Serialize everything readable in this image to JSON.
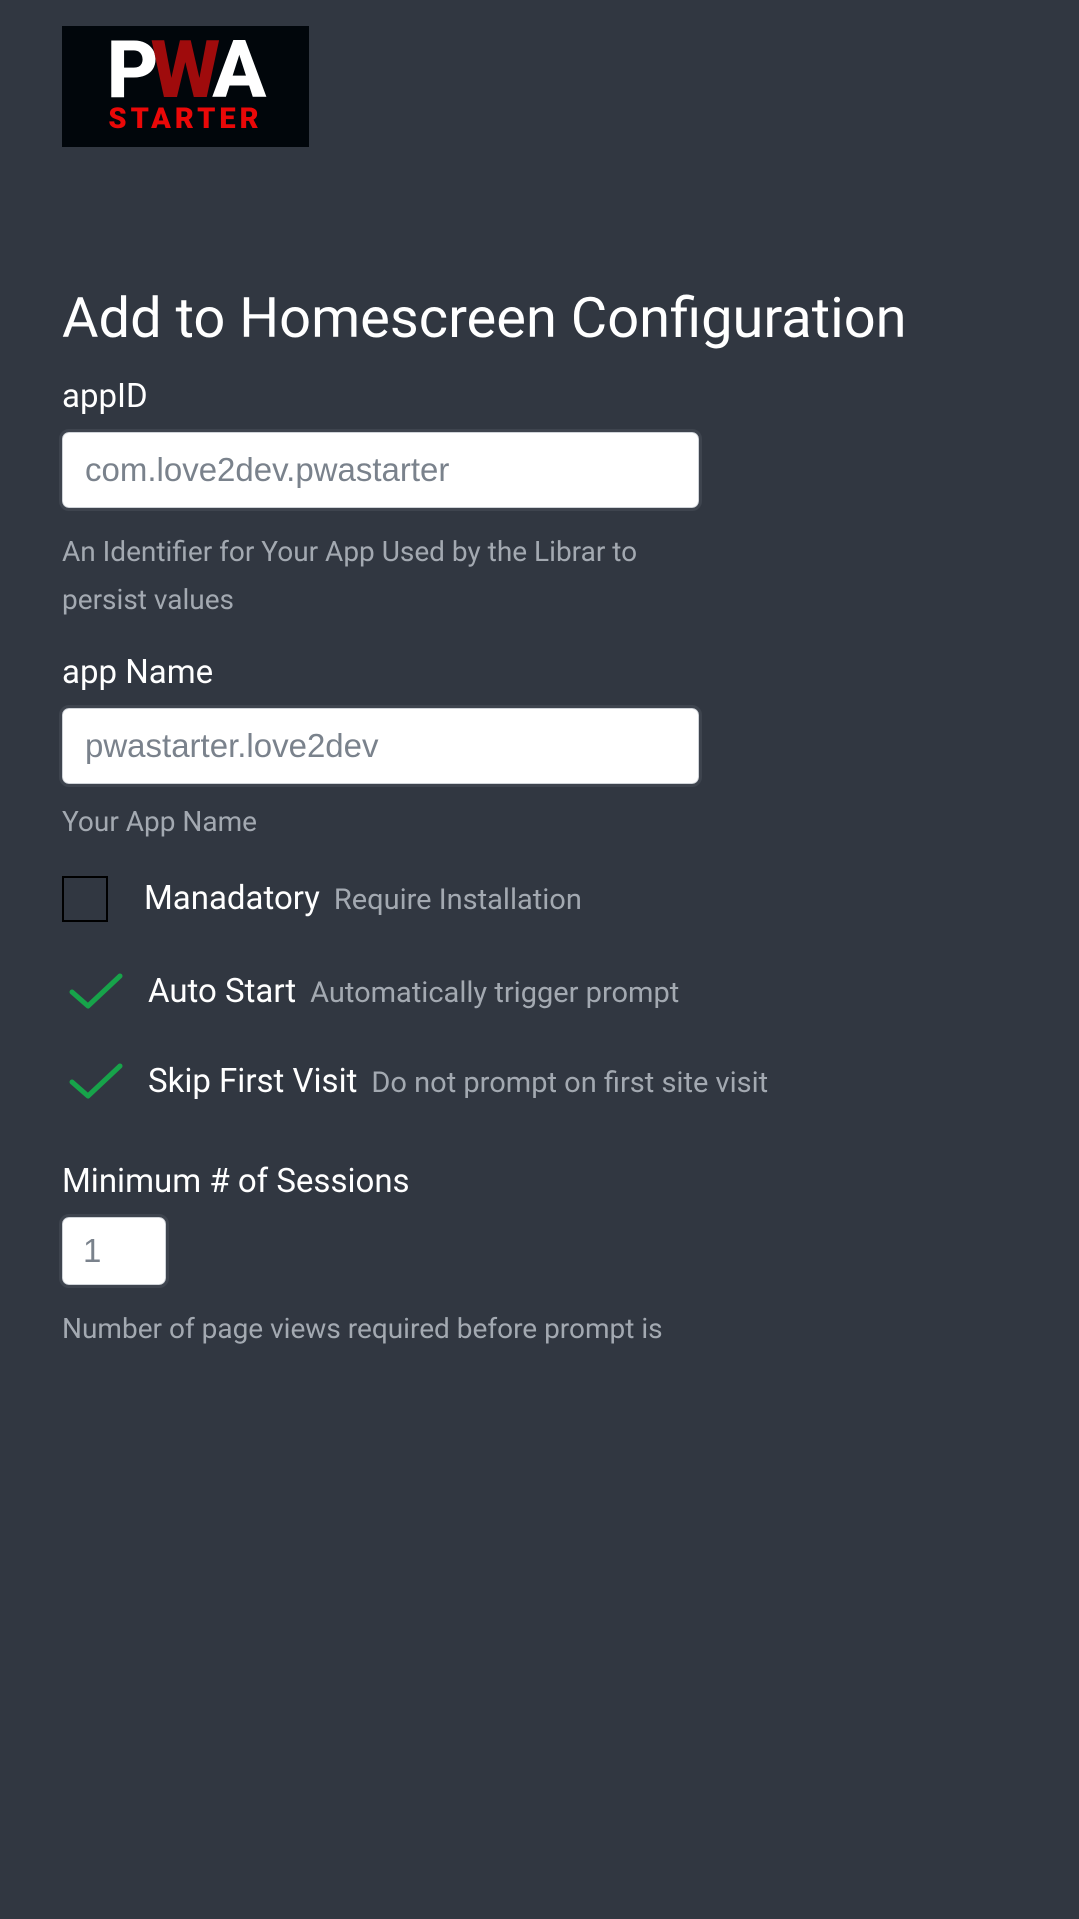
{
  "logo": {
    "p": "P",
    "w": "W",
    "a": "A",
    "sub": "STARTER"
  },
  "page_title": "Add to Homescreen Configuration",
  "fields": {
    "app_id": {
      "label": "appID",
      "value": "com.love2dev.pwastarter",
      "help": "An Identifier for Your App Used by the Librar to persist values"
    },
    "app_name": {
      "label": "app Name",
      "value": "pwastarter.love2dev",
      "help": "Your App Name"
    },
    "mandatory": {
      "label": "Manadatory",
      "desc": "Require Installation",
      "checked": false
    },
    "auto_start": {
      "label": "Auto Start",
      "desc": "Automatically trigger prompt",
      "checked": true
    },
    "skip_first": {
      "label": "Skip First Visit",
      "desc": "Do not prompt on first site visit",
      "checked": true
    },
    "min_sessions": {
      "label": "Minimum # of Sessions",
      "value": "1",
      "help": "Number of page views required before prompt is"
    }
  }
}
